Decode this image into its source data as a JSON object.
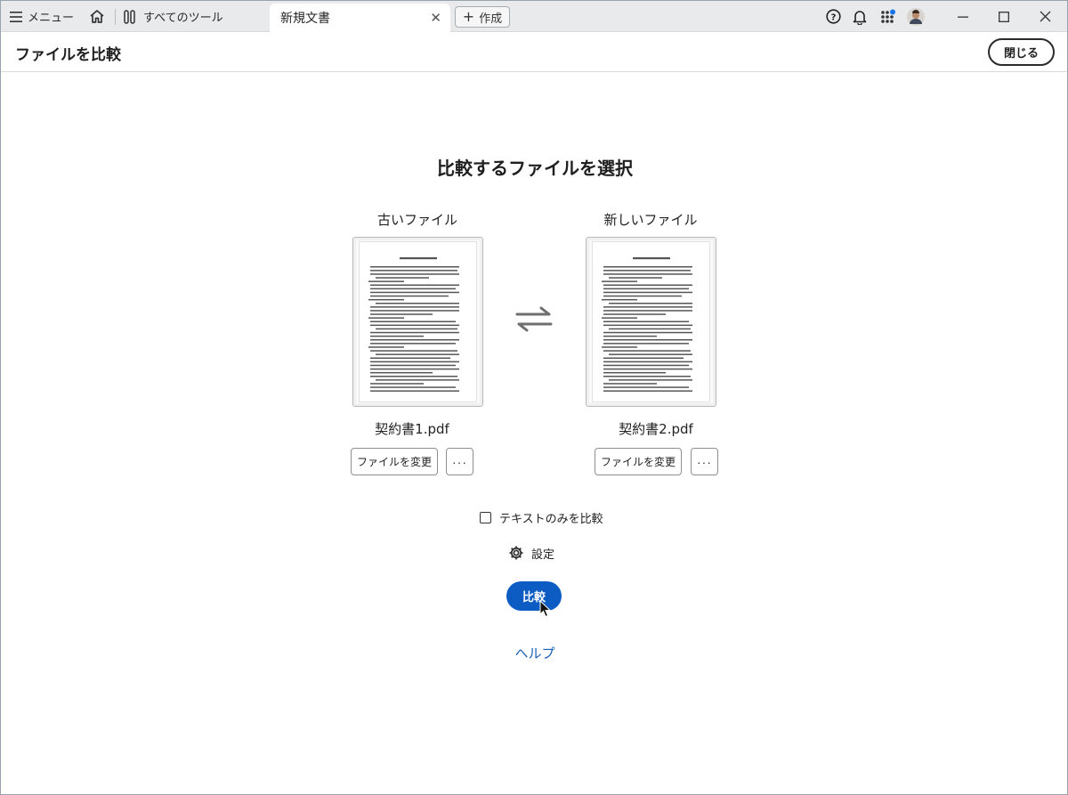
{
  "tabbar": {
    "menu_label": "メニュー",
    "tools_label": "すべてのツール",
    "doc_tab_label": "新規文書",
    "create_label": "作成"
  },
  "header": {
    "title": "ファイルを比較",
    "close_label": "閉じる"
  },
  "main": {
    "title": "比較するファイルを選択",
    "old_file": {
      "label": "古いファイル",
      "file_name": "契約書1.pdf",
      "change_label": "ファイルを変更",
      "more_label": "···"
    },
    "new_file": {
      "label": "新しいファイル",
      "file_name": "契約書2.pdf",
      "change_label": "ファイルを変更",
      "more_label": "···"
    },
    "text_only_label": "テキストのみを比較",
    "text_only_checked": false,
    "settings_label": "設定",
    "compare_label": "比較",
    "help_label": "ヘルプ"
  },
  "colors": {
    "accent": "#0d5cc4",
    "link": "#1a5fb4",
    "tabbar_bg": "#e9eaec",
    "notification_dot": "#1a73e8"
  },
  "icons": [
    "hamburger-icon",
    "home-icon",
    "tools-icon",
    "close-icon",
    "plus-icon",
    "help-icon",
    "bell-icon",
    "apps-grid-icon",
    "avatar",
    "minimize-icon",
    "maximize-icon",
    "window-close-icon",
    "swap-icon",
    "gear-icon",
    "cursor-icon"
  ]
}
